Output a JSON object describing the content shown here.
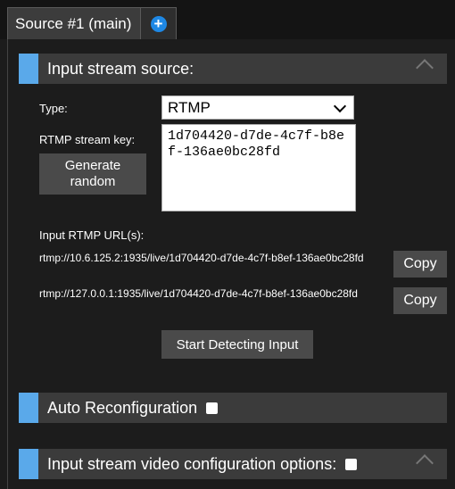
{
  "tabs": [
    {
      "label": "Source #1 (main)"
    }
  ],
  "add_tab_icon": "plus-circle-icon",
  "sections": {
    "input_source": {
      "title": "Input stream source:",
      "type_label": "Type:",
      "type_value": "RTMP",
      "stream_key_label": "RTMP stream key:",
      "stream_key_value": "1d704420-d7de-4c7f-b8ef-136ae0bc28fd",
      "generate_button": "Generate random",
      "urls_label": "Input RTMP URL(s):",
      "urls": [
        {
          "url": "rtmp://10.6.125.2:1935/live/1d704420-d7de-4c7f-b8ef-136ae0bc28fd",
          "copy_label": "Copy"
        },
        {
          "url": "rtmp://127.0.0.1:1935/live/1d704420-d7de-4c7f-b8ef-136ae0bc28fd",
          "copy_label": "Copy"
        }
      ],
      "detect_button": "Start Detecting Input"
    },
    "auto_reconfig": {
      "title": "Auto Reconfiguration"
    },
    "video_config": {
      "title": "Input stream video configuration options:"
    }
  },
  "colors": {
    "accent": "#5aa9ea",
    "tab_add": "#1e88e5",
    "header_bg": "#3b3b3b",
    "button_bg": "#4a4a4a",
    "page_bg": "#1c1c1c"
  }
}
